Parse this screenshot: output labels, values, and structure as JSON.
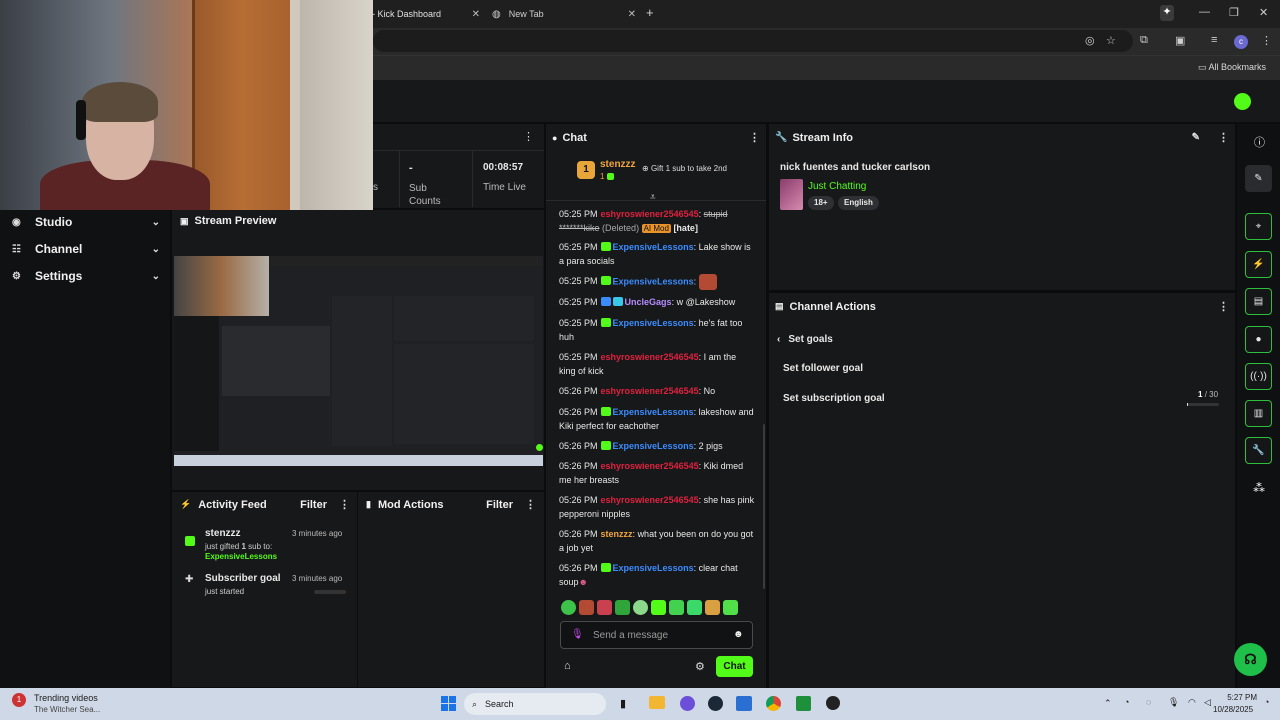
{
  "browser": {
    "tabs": [
      {
        "label": "- Kick Dashboard"
      },
      {
        "label": "New Tab"
      }
    ],
    "all_bookmarks": "All Bookmarks"
  },
  "sidebar": {
    "items": [
      {
        "label": "Studio",
        "icon": "studio-icon"
      },
      {
        "label": "Channel",
        "icon": "channel-icon"
      },
      {
        "label": "Settings",
        "icon": "gear-icon"
      }
    ]
  },
  "stats": {
    "c1_value": "",
    "c1_label": "s",
    "c2_value": "-",
    "c2_label": "Sub Counts",
    "c3_value": "00:08:57",
    "c3_label": "Time Live"
  },
  "stream_preview": {
    "title": "Stream Preview"
  },
  "activity_feed": {
    "title": "Activity Feed",
    "filter": "Filter",
    "items": [
      {
        "title": "stenzzz",
        "time": "3 minutes ago",
        "line1_pre": "just gifted ",
        "line1_bold": "1",
        "line1_post": " sub to:",
        "line2": "ExpensiveLessons"
      },
      {
        "title": "Subscriber goal",
        "time": "3 minutes ago",
        "line1": "just started"
      }
    ]
  },
  "mod_actions": {
    "title": "Mod Actions",
    "filter": "Filter"
  },
  "chat": {
    "title": "Chat",
    "top_gifter": {
      "rank": "1",
      "name": "stenzzz",
      "count": "1"
    },
    "gift_cta": "Gift 1 sub to take 2nd",
    "messages": [
      {
        "time": "05:25 PM",
        "user": "eshyroswiener2546545",
        "text": "stupid *******kike",
        "deleted": "(Deleted)",
        "aimod": "AI Mod",
        "tag": "[hate]"
      },
      {
        "time": "05:25 PM",
        "user": "ExpensiveLessons",
        "text": "Lake show is a para socials"
      },
      {
        "time": "05:25 PM",
        "user": "ExpensiveLessons",
        "text": ""
      },
      {
        "time": "05:25 PM",
        "user": "UncleGags",
        "text": "w @Lakeshow"
      },
      {
        "time": "05:25 PM",
        "user": "ExpensiveLessons",
        "text": "he's fat too huh"
      },
      {
        "time": "05:25 PM",
        "user": "eshyroswiener2546545",
        "text": "I am the king of kick"
      },
      {
        "time": "05:26 PM",
        "user": "eshyroswiener2546545",
        "text": "No"
      },
      {
        "time": "05:26 PM",
        "user": "ExpensiveLessons",
        "text": "lakeshow and Kiki perfect for eachother"
      },
      {
        "time": "05:26 PM",
        "user": "ExpensiveLessons",
        "text": "2 pigs"
      },
      {
        "time": "05:26 PM",
        "user": "eshyroswiener2546545",
        "text": "Kiki dmed me her breasts"
      },
      {
        "time": "05:26 PM",
        "user": "eshyroswiener2546545",
        "text": "she has pink pepperoni nipples"
      },
      {
        "time": "05:26 PM",
        "user": "stenzzz",
        "text": "what you been on do you got a job yet"
      },
      {
        "time": "05:26 PM",
        "user": "ExpensiveLessons",
        "text": "clear chat soup"
      }
    ],
    "input_placeholder": "Send a message",
    "send_label": "Chat"
  },
  "stream_info": {
    "title": "Stream Info",
    "stream_title": "nick fuentes and tucker carlson",
    "category": "Just Chatting",
    "tags": [
      "18+",
      "English"
    ]
  },
  "channel_actions": {
    "title": "Channel Actions",
    "back_label": "Set goals",
    "follower_goal": "Set follower goal",
    "subscription_goal": "Set subscription goal",
    "sub_progress_current": "1",
    "sub_progress_total": "/ 30",
    "sub_progress_fraction": 0.033
  },
  "taskbar": {
    "news_title": "Trending videos",
    "news_sub": "The Witcher Sea...",
    "search": "Search",
    "time": "5:27 PM",
    "date": "10/28/2025"
  },
  "colors": {
    "accent": "#53fc18",
    "panel": "#17181a",
    "background": "#0b0c0e"
  }
}
